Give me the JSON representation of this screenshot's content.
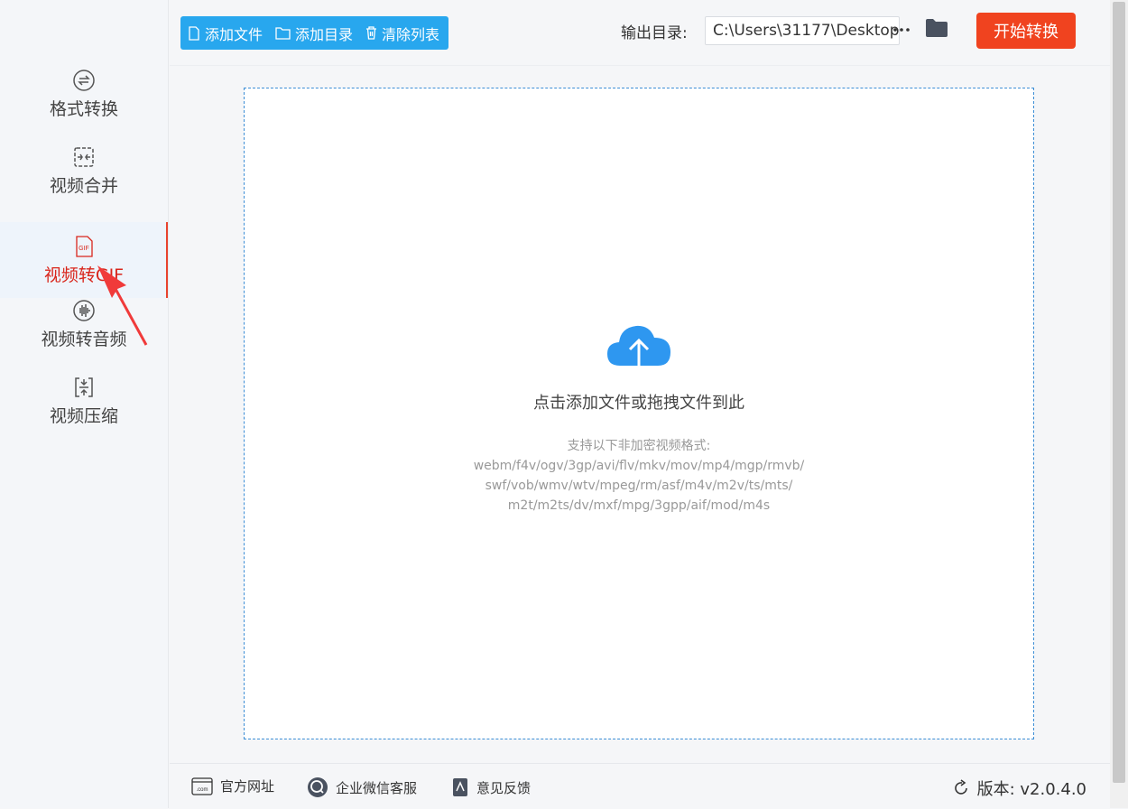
{
  "sidebar": {
    "items": [
      {
        "label": "格式转换",
        "icon": "swap-circle-icon",
        "active": false
      },
      {
        "label": "视频合并",
        "icon": "merge-icon",
        "active": false
      },
      {
        "label": "视频转GIF",
        "icon": "gif-file-icon",
        "active": true
      },
      {
        "label": "视频转音频",
        "icon": "audio-wave-icon",
        "active": false
      },
      {
        "label": "视频压缩",
        "icon": "compress-icon",
        "active": false
      }
    ]
  },
  "toolbar": {
    "add_file": "添加文件",
    "add_dir": "添加目录",
    "clear_list": "清除列表",
    "output_label": "输出目录:",
    "output_path": "C:\\Users\\31177\\Desktop",
    "start_label": "开始转换"
  },
  "dropzone": {
    "title": "点击添加文件或拖拽文件到此",
    "formats_heading": "支持以下非加密视频格式:",
    "formats_lines": [
      "webm/f4v/ogv/3gp/avi/flv/mkv/mov/mp4/mgp/rmvb/",
      "swf/vob/wmv/wtv/mpeg/rm/asf/m4v/m2v/ts/mts/",
      "m2t/m2ts/dv/mxf/mpg/3gpp/aif/mod/m4s"
    ]
  },
  "footer": {
    "website": "官方网址",
    "wechat": "企业微信客服",
    "feedback": "意见反馈",
    "version": "版本: v2.0.4.0"
  },
  "colors": {
    "accent_blue": "#28a7ee",
    "start_red": "#f0431f",
    "active_red": "#d9261c",
    "dropzone_border": "#3c8ed6",
    "upload_cloud": "#2e97f0"
  }
}
